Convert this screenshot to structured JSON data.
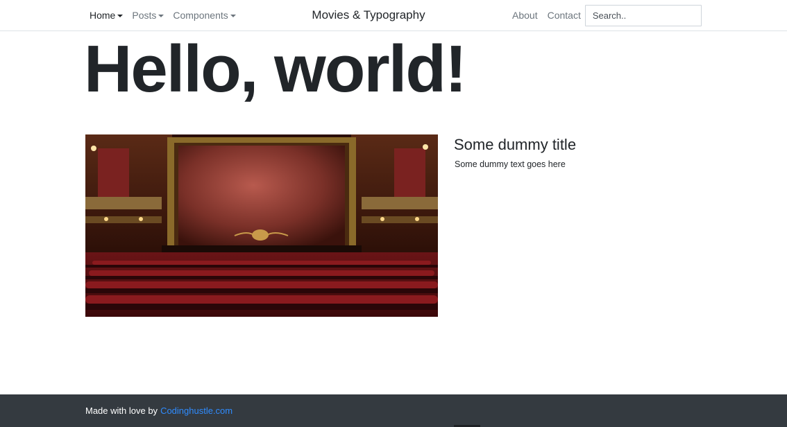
{
  "navbar": {
    "left_items": [
      {
        "label": "Home",
        "active": true
      },
      {
        "label": "Posts",
        "active": false
      },
      {
        "label": "Components",
        "active": false
      }
    ],
    "brand": "Movies & Typography",
    "right_links": [
      "About",
      "Contact"
    ],
    "search": {
      "placeholder": "Search..",
      "value": ""
    }
  },
  "main": {
    "heading": "Hello, world!",
    "card": {
      "title": "Some dummy title",
      "text": "Some dummy text goes here"
    }
  },
  "footer": {
    "text": "Made with love by",
    "link": "Codinghustle.com",
    "link_color": "#2f8cff",
    "background": "#343a40"
  }
}
